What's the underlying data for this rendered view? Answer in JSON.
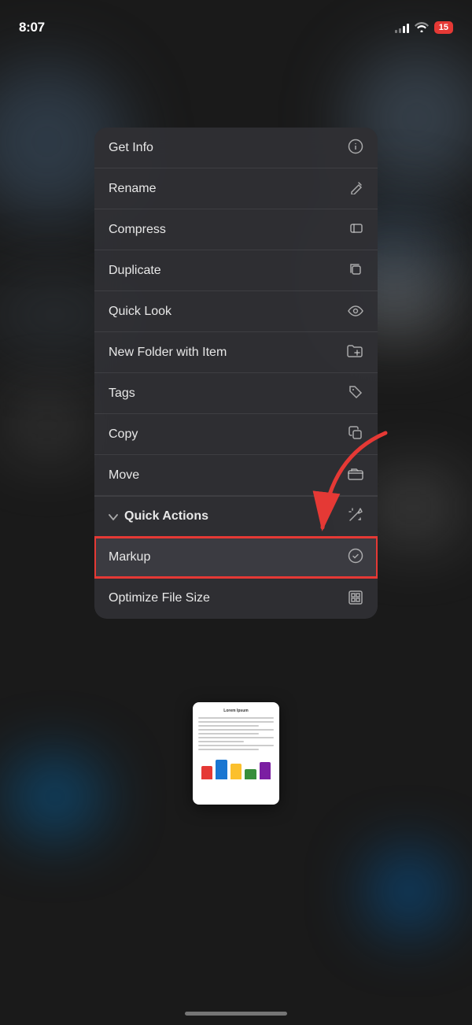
{
  "statusBar": {
    "time": "8:07",
    "battery": "15"
  },
  "menu": {
    "items": [
      {
        "id": "get-info",
        "label": "Get Info",
        "icon": "ℹ"
      },
      {
        "id": "rename",
        "label": "Rename",
        "icon": "✏"
      },
      {
        "id": "compress",
        "label": "Compress",
        "icon": "⊟"
      },
      {
        "id": "duplicate",
        "label": "Duplicate",
        "icon": "⊕"
      },
      {
        "id": "quick-look",
        "label": "Quick Look",
        "icon": "👁"
      },
      {
        "id": "new-folder-with-item",
        "label": "New Folder with Item",
        "icon": "🗂"
      },
      {
        "id": "tags",
        "label": "Tags",
        "icon": "◇"
      },
      {
        "id": "copy",
        "label": "Copy",
        "icon": "⧉"
      },
      {
        "id": "move",
        "label": "Move",
        "icon": "⬜"
      }
    ],
    "quickActions": {
      "label": "Quick Actions",
      "chevron": "⌄",
      "icon": "✦",
      "items": [
        {
          "id": "markup",
          "label": "Markup",
          "icon": "⊛",
          "highlighted": true
        },
        {
          "id": "optimize-file-size",
          "label": "Optimize File Size",
          "icon": "🖼"
        }
      ]
    }
  },
  "homeIndicator": {}
}
